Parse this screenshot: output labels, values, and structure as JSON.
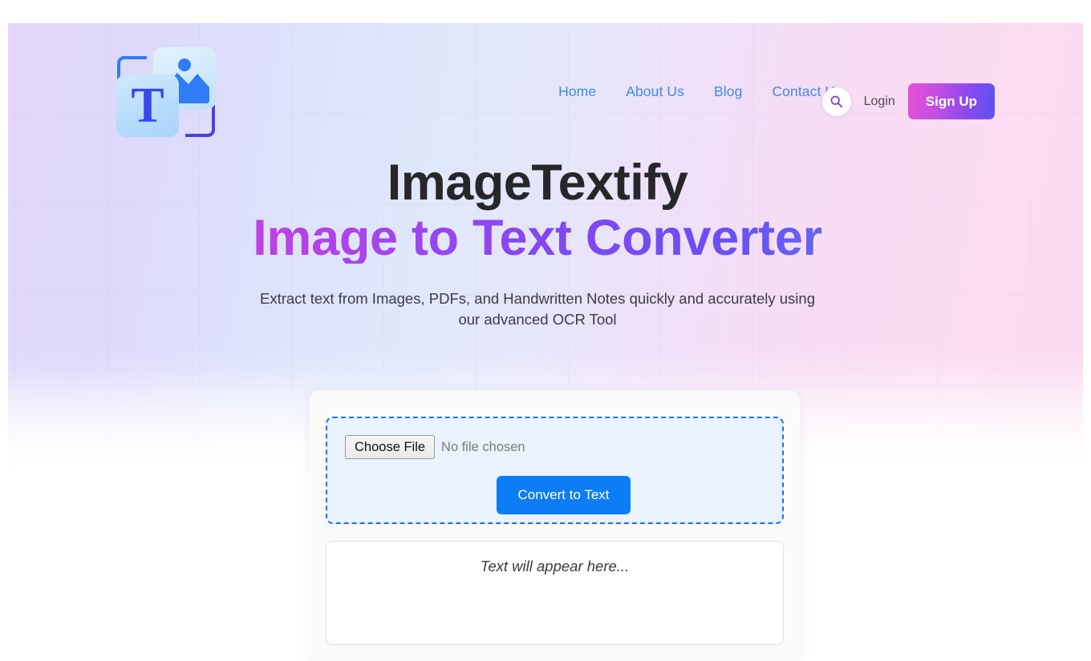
{
  "header": {
    "logo": {
      "name": "imagetextify-logo",
      "letter": "T"
    },
    "nav": [
      {
        "label": "Home",
        "name": "nav-link-home"
      },
      {
        "label": "About Us",
        "name": "nav-link-about-us"
      },
      {
        "label": "Blog",
        "name": "nav-link-blog"
      },
      {
        "label": "Contact Us",
        "name": "nav-link-contact-us"
      }
    ],
    "search_icon": "search-icon",
    "login_label": "Login",
    "signup_label": "Sign Up"
  },
  "hero": {
    "title_line1": "ImageTextify",
    "title_line2": "Image to Text Converter",
    "subtitle": "Extract text from Images, PDFs, and Handwritten Notes quickly and accurately using our advanced OCR Tool"
  },
  "converter": {
    "choose_file_label": "Choose File",
    "file_status": "No file chosen",
    "convert_label": "Convert to Text",
    "output_placeholder": "Text will appear here..."
  },
  "colors": {
    "nav_link": "#3e8ae8",
    "convert_button": "#0d7df5",
    "dropzone_border": "#1a74e8",
    "dropzone_fill": "#e9f2fd",
    "signup_gradient_start": "#e452d8",
    "signup_gradient_end": "#5b51f0",
    "title_gradient_start": "#f23fd0",
    "title_gradient_end": "#4f93ef",
    "heading_dark": "#272629",
    "hero_gradient_left": "#e3d7fb",
    "hero_gradient_mid": "#dfe8fb",
    "hero_gradient_right": "#fadaf0"
  }
}
